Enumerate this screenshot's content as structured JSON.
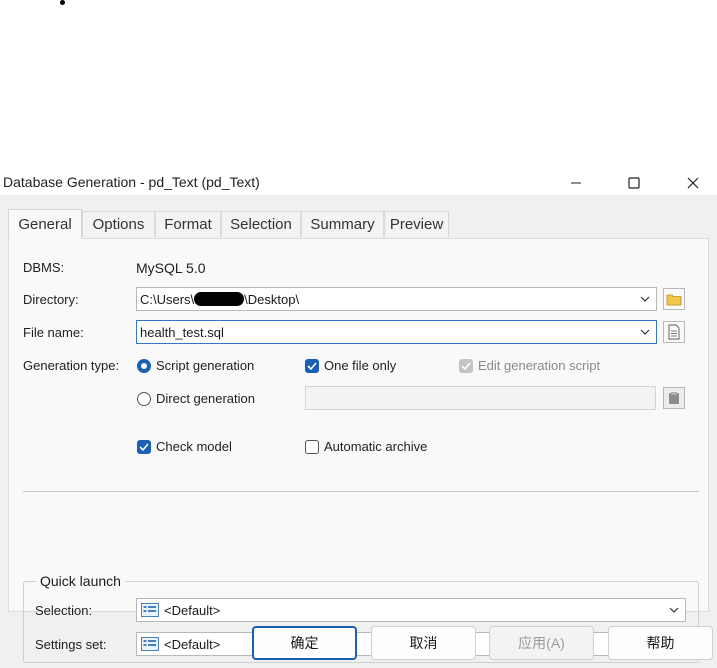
{
  "window": {
    "title": "Database Generation - pd_Text (pd_Text)"
  },
  "tabs": [
    "General",
    "Options",
    "Format",
    "Selection",
    "Summary",
    "Preview"
  ],
  "general": {
    "dbms_label": "DBMS:",
    "dbms_value": "MySQL 5.0",
    "directory_label": "Directory:",
    "directory_value_prefix": "C:\\Users\\",
    "directory_value_suffix": "\\Desktop\\",
    "filename_label": "File name:",
    "filename_value": "health_test.sql",
    "generation_type_label": "Generation type:",
    "script_generation": "Script generation",
    "one_file_only": "One file only",
    "edit_generation_script": "Edit generation script",
    "direct_generation": "Direct generation",
    "check_model": "Check model",
    "automatic_archive": "Automatic archive"
  },
  "quick_launch": {
    "title": "Quick launch",
    "selection_label": "Selection:",
    "selection_value": "<Default>",
    "settings_label": "Settings set:",
    "settings_value": "<Default>"
  },
  "buttons": {
    "ok": "确定",
    "cancel": "取消",
    "apply": "应用(A)",
    "help": "帮助"
  },
  "state": {
    "script_generation_selected": true,
    "one_file_only_checked": true,
    "edit_generation_script_checked": true,
    "edit_generation_script_disabled": true,
    "check_model_checked": true,
    "automatic_archive_checked": false
  },
  "colors": {
    "accent": "#1a5fb4",
    "focus_border": "#2f78d0"
  }
}
